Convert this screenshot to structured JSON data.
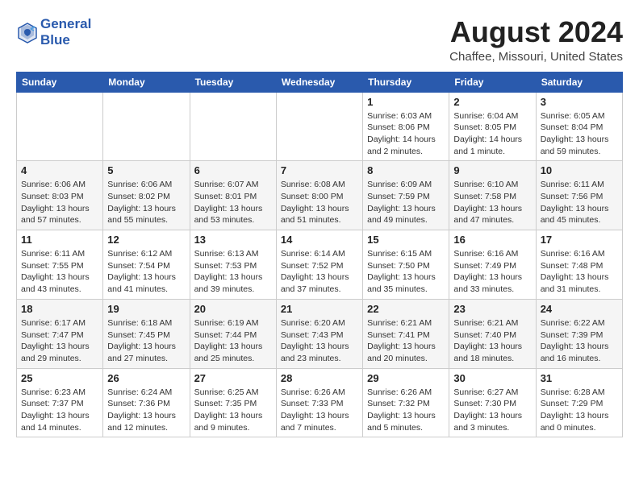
{
  "header": {
    "logo_line1": "General",
    "logo_line2": "Blue",
    "month_year": "August 2024",
    "location": "Chaffee, Missouri, United States"
  },
  "weekdays": [
    "Sunday",
    "Monday",
    "Tuesday",
    "Wednesday",
    "Thursday",
    "Friday",
    "Saturday"
  ],
  "weeks": [
    [
      {
        "day": "",
        "info": ""
      },
      {
        "day": "",
        "info": ""
      },
      {
        "day": "",
        "info": ""
      },
      {
        "day": "",
        "info": ""
      },
      {
        "day": "1",
        "info": "Sunrise: 6:03 AM\nSunset: 8:06 PM\nDaylight: 14 hours\nand 2 minutes."
      },
      {
        "day": "2",
        "info": "Sunrise: 6:04 AM\nSunset: 8:05 PM\nDaylight: 14 hours\nand 1 minute."
      },
      {
        "day": "3",
        "info": "Sunrise: 6:05 AM\nSunset: 8:04 PM\nDaylight: 13 hours\nand 59 minutes."
      }
    ],
    [
      {
        "day": "4",
        "info": "Sunrise: 6:06 AM\nSunset: 8:03 PM\nDaylight: 13 hours\nand 57 minutes."
      },
      {
        "day": "5",
        "info": "Sunrise: 6:06 AM\nSunset: 8:02 PM\nDaylight: 13 hours\nand 55 minutes."
      },
      {
        "day": "6",
        "info": "Sunrise: 6:07 AM\nSunset: 8:01 PM\nDaylight: 13 hours\nand 53 minutes."
      },
      {
        "day": "7",
        "info": "Sunrise: 6:08 AM\nSunset: 8:00 PM\nDaylight: 13 hours\nand 51 minutes."
      },
      {
        "day": "8",
        "info": "Sunrise: 6:09 AM\nSunset: 7:59 PM\nDaylight: 13 hours\nand 49 minutes."
      },
      {
        "day": "9",
        "info": "Sunrise: 6:10 AM\nSunset: 7:58 PM\nDaylight: 13 hours\nand 47 minutes."
      },
      {
        "day": "10",
        "info": "Sunrise: 6:11 AM\nSunset: 7:56 PM\nDaylight: 13 hours\nand 45 minutes."
      }
    ],
    [
      {
        "day": "11",
        "info": "Sunrise: 6:11 AM\nSunset: 7:55 PM\nDaylight: 13 hours\nand 43 minutes."
      },
      {
        "day": "12",
        "info": "Sunrise: 6:12 AM\nSunset: 7:54 PM\nDaylight: 13 hours\nand 41 minutes."
      },
      {
        "day": "13",
        "info": "Sunrise: 6:13 AM\nSunset: 7:53 PM\nDaylight: 13 hours\nand 39 minutes."
      },
      {
        "day": "14",
        "info": "Sunrise: 6:14 AM\nSunset: 7:52 PM\nDaylight: 13 hours\nand 37 minutes."
      },
      {
        "day": "15",
        "info": "Sunrise: 6:15 AM\nSunset: 7:50 PM\nDaylight: 13 hours\nand 35 minutes."
      },
      {
        "day": "16",
        "info": "Sunrise: 6:16 AM\nSunset: 7:49 PM\nDaylight: 13 hours\nand 33 minutes."
      },
      {
        "day": "17",
        "info": "Sunrise: 6:16 AM\nSunset: 7:48 PM\nDaylight: 13 hours\nand 31 minutes."
      }
    ],
    [
      {
        "day": "18",
        "info": "Sunrise: 6:17 AM\nSunset: 7:47 PM\nDaylight: 13 hours\nand 29 minutes."
      },
      {
        "day": "19",
        "info": "Sunrise: 6:18 AM\nSunset: 7:45 PM\nDaylight: 13 hours\nand 27 minutes."
      },
      {
        "day": "20",
        "info": "Sunrise: 6:19 AM\nSunset: 7:44 PM\nDaylight: 13 hours\nand 25 minutes."
      },
      {
        "day": "21",
        "info": "Sunrise: 6:20 AM\nSunset: 7:43 PM\nDaylight: 13 hours\nand 23 minutes."
      },
      {
        "day": "22",
        "info": "Sunrise: 6:21 AM\nSunset: 7:41 PM\nDaylight: 13 hours\nand 20 minutes."
      },
      {
        "day": "23",
        "info": "Sunrise: 6:21 AM\nSunset: 7:40 PM\nDaylight: 13 hours\nand 18 minutes."
      },
      {
        "day": "24",
        "info": "Sunrise: 6:22 AM\nSunset: 7:39 PM\nDaylight: 13 hours\nand 16 minutes."
      }
    ],
    [
      {
        "day": "25",
        "info": "Sunrise: 6:23 AM\nSunset: 7:37 PM\nDaylight: 13 hours\nand 14 minutes."
      },
      {
        "day": "26",
        "info": "Sunrise: 6:24 AM\nSunset: 7:36 PM\nDaylight: 13 hours\nand 12 minutes."
      },
      {
        "day": "27",
        "info": "Sunrise: 6:25 AM\nSunset: 7:35 PM\nDaylight: 13 hours\nand 9 minutes."
      },
      {
        "day": "28",
        "info": "Sunrise: 6:26 AM\nSunset: 7:33 PM\nDaylight: 13 hours\nand 7 minutes."
      },
      {
        "day": "29",
        "info": "Sunrise: 6:26 AM\nSunset: 7:32 PM\nDaylight: 13 hours\nand 5 minutes."
      },
      {
        "day": "30",
        "info": "Sunrise: 6:27 AM\nSunset: 7:30 PM\nDaylight: 13 hours\nand 3 minutes."
      },
      {
        "day": "31",
        "info": "Sunrise: 6:28 AM\nSunset: 7:29 PM\nDaylight: 13 hours\nand 0 minutes."
      }
    ]
  ]
}
